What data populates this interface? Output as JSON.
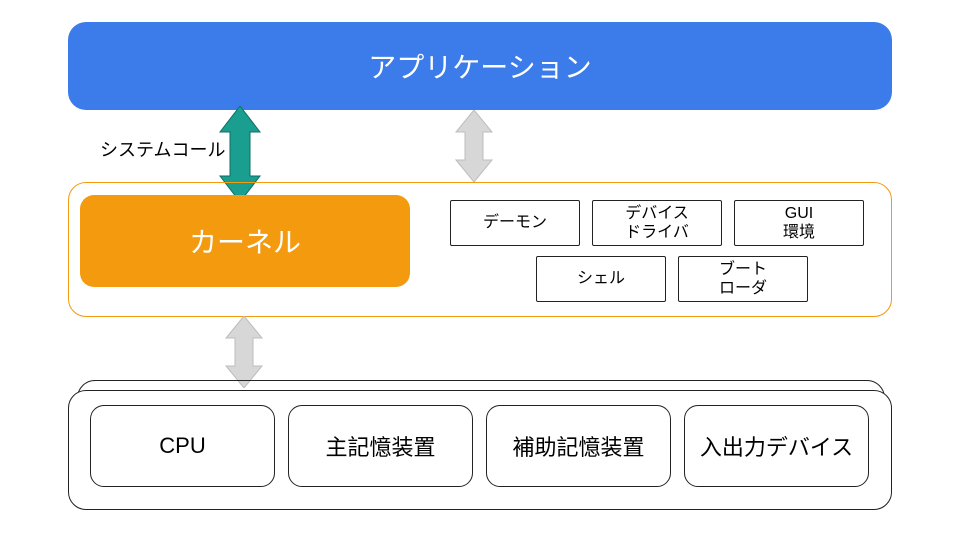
{
  "diagram": {
    "application": "アプリケーション",
    "syscall_label": "システムコール",
    "kernel": "カーネル",
    "os_modules": {
      "daemon": "デーモン",
      "device_driver": "デバイス\nドライバ",
      "gui_env": "GUI\n環境",
      "shell": "シェル",
      "boot_loader": "ブート\nローダ"
    },
    "hardware": {
      "cpu": "CPU",
      "main_memory": "主記憶装置",
      "aux_storage": "補助記憶装置",
      "io_device": "入出力デバイス"
    }
  },
  "colors": {
    "app_bg": "#3b7bea",
    "kernel_bg": "#f39a0f",
    "os_border": "#f39a0f",
    "teal": "#199e8f",
    "gray": "#d7d7d7"
  }
}
